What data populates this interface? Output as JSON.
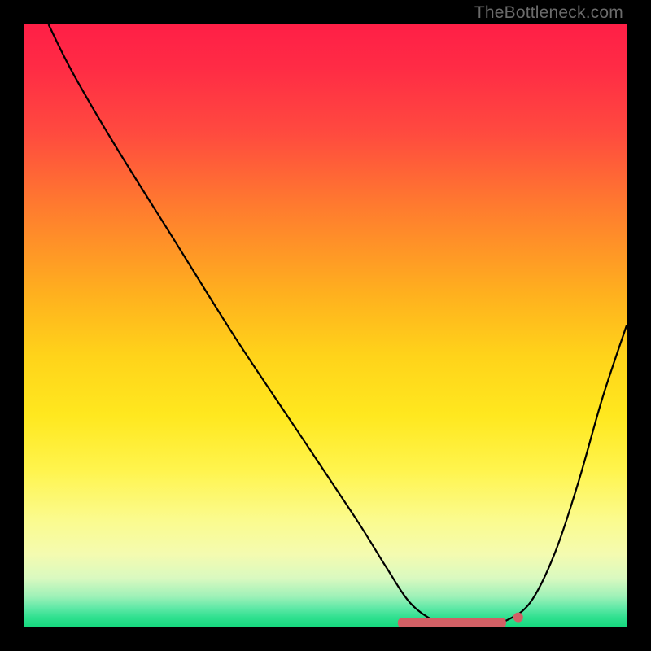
{
  "watermark": {
    "text": "TheBottleneck.com"
  },
  "colors": {
    "curve_stroke": "#000000",
    "marker_fill": "#d16065",
    "marker_stroke": "#d16065"
  },
  "chart_data": {
    "type": "line",
    "title": "",
    "xlabel": "",
    "ylabel": "",
    "xlim": [
      0,
      100
    ],
    "ylim": [
      0,
      100
    ],
    "grid": false,
    "legend": false,
    "series": [
      {
        "name": "bottleneck-curve",
        "x": [
          4,
          8,
          15,
          25,
          35,
          45,
          55,
          60,
          64,
          68,
          72,
          76,
          80,
          84,
          88,
          92,
          96,
          100
        ],
        "values": [
          100,
          92,
          80,
          64,
          48,
          33,
          18,
          10,
          4,
          1,
          0,
          0,
          1,
          4,
          12,
          24,
          38,
          50
        ]
      }
    ],
    "markers": {
      "name": "highlighted-range",
      "shape": "pill",
      "x_start": 62,
      "x_end": 80,
      "y": 0,
      "dot_x": 82,
      "dot_y": 1
    }
  }
}
